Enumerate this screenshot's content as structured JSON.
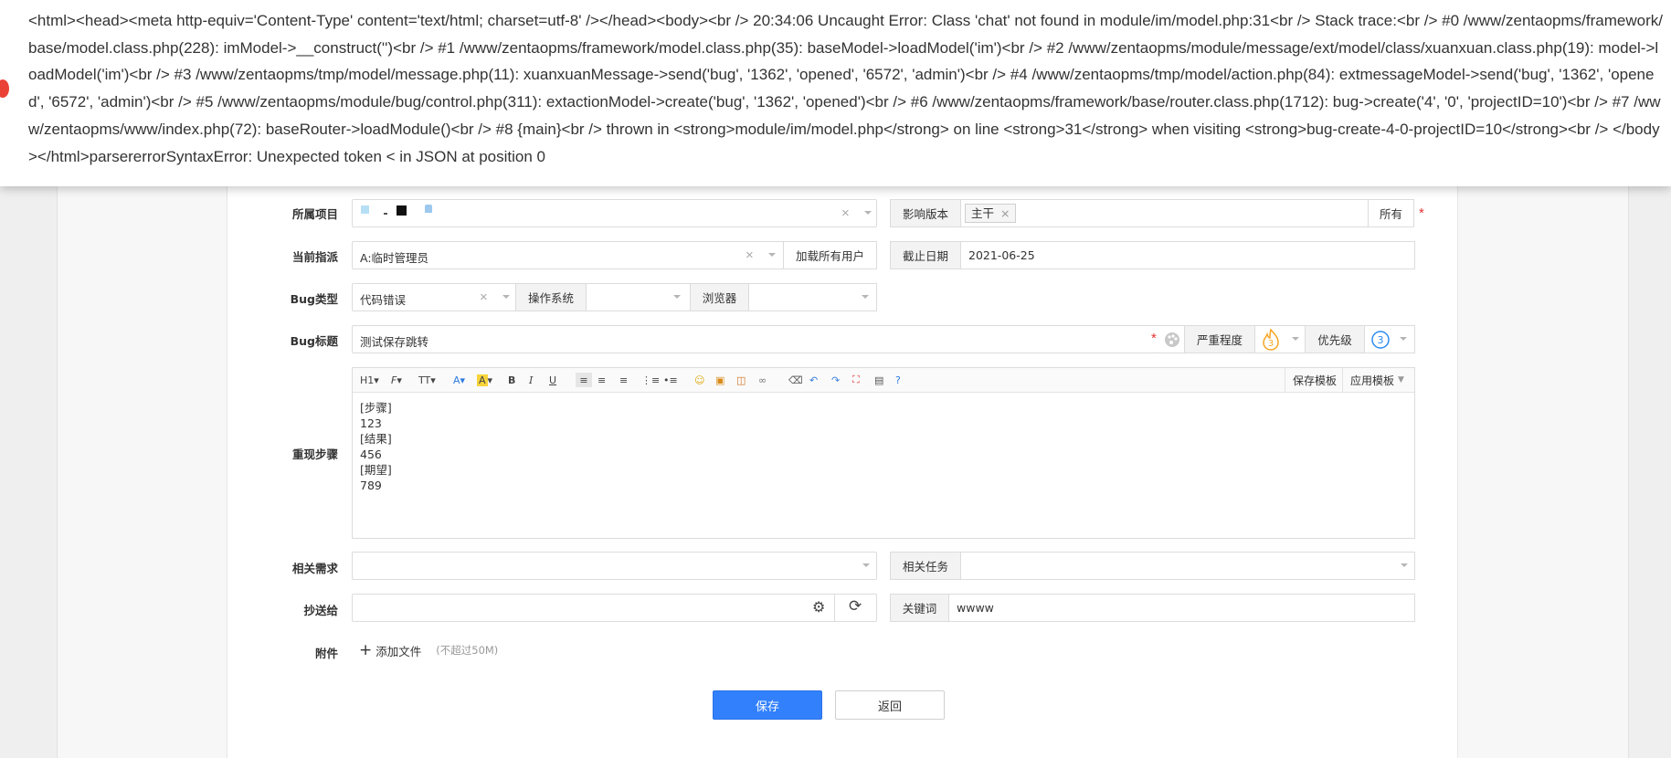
{
  "error": {
    "text": "<html><head><meta http-equiv='Content-Type' content='text/html; charset=utf-8' /></head><body><br /> 20:34:06 Uncaught Error: Class 'chat' not found in module/im/model.php:31<br /> Stack trace:<br /> #0 /www/zentaopms/framework/base/model.class.php(228): imModel->__construct('')<br /> #1 /www/zentaopms/framework/model.class.php(35): baseModel->loadModel('im')<br /> #2 /www/zentaopms/module/message/ext/model/class/xuanxuan.class.php(19): model->loadModel('im')<br /> #3 /www/zentaopms/tmp/model/message.php(11): xuanxuanMessage->send('bug', '1362', 'opened', '6572', 'admin')<br /> #4 /www/zentaopms/tmp/model/action.php(84): extmessageModel->send('bug', '1362', 'opened', '6572', 'admin')<br /> #5 /www/zentaopms/module/bug/control.php(311): extactionModel->create('bug', '1362', 'opened')<br /> #6 /www/zentaopms/framework/base/router.class.php(1712): bug->create('4', '0', 'projectID=10')<br /> #7 /www/zentaopms/www/index.php(72): baseRouter->loadModule()<br /> #8 {main}<br /> thrown in <strong>module/im/model.php</strong> on line <strong>31</strong> when visiting <strong>bug-create-4-0-projectID=10</strong><br /> </body></html>parsererrorSyntaxError: Unexpected token < in JSON at position 0"
  },
  "form": {
    "project_label": "所属项目",
    "build_label": "影响版本",
    "build_tag": "主干",
    "build_all": "所有",
    "assign_label": "当前指派",
    "assign_value": "A:临时管理员",
    "load_users": "加载所有用户",
    "deadline_label": "截止日期",
    "deadline_value": "2021-06-25",
    "type_label": "Bug类型",
    "type_value": "代码错误",
    "os_label": "操作系统",
    "browser_label": "浏览器",
    "title_label": "Bug标题",
    "title_value": "测试保存跳转",
    "severity_label": "严重程度",
    "severity_value": "3",
    "priority_label": "优先级",
    "priority_value": "3",
    "steps_label": "重现步骤",
    "steps_lines": [
      "[步骤]",
      "123",
      "[结果]",
      "456",
      "[期望]",
      "789"
    ],
    "save_template": "保存模板",
    "apply_template": "应用模板",
    "story_label": "相关需求",
    "task_label": "相关任务",
    "cc_label": "抄送给",
    "keywords_label": "关键词",
    "keywords_value": "wwww",
    "files_label": "附件",
    "add_file": "添加文件",
    "file_limit": "(不超过50M)",
    "save": "保存",
    "back": "返回"
  },
  "toolbar": [
    "H1",
    "F",
    "TT",
    "A",
    "A",
    "B",
    "I",
    "U"
  ],
  "colors": {
    "primary": "#3280fc",
    "error_dot": "#ea4335",
    "required": "#e53333",
    "severity": "#f5a623",
    "priority": "#2d8cf0"
  }
}
